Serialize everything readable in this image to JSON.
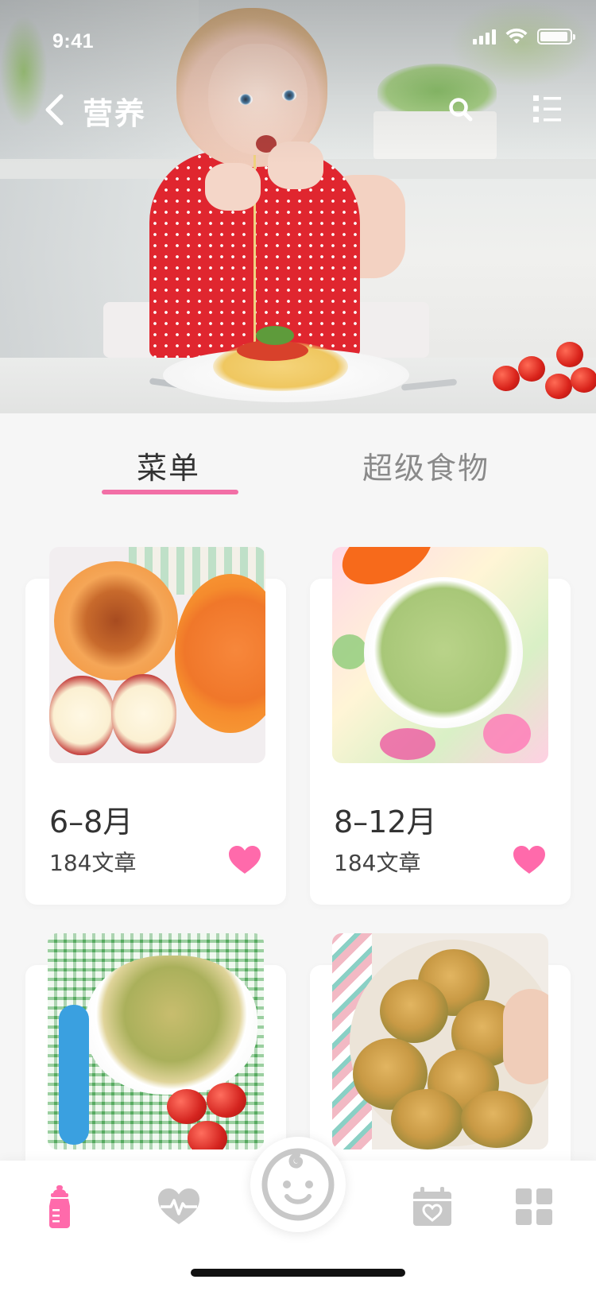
{
  "status_bar": {
    "time": "9:41",
    "signal_bars": 4,
    "battery_level": 0.95
  },
  "nav": {
    "title": "营养",
    "back_icon": "chevron-left-icon",
    "search_icon": "search-icon",
    "menu_icon": "list-icon"
  },
  "hero": {
    "photo": "child eating spaghetti"
  },
  "tabs": [
    {
      "label": "菜单",
      "active": true
    },
    {
      "label": "超级食物",
      "active": false
    }
  ],
  "cards": [
    {
      "title": "6–8月",
      "subtitle": "184文章",
      "photo": "squash, apples and orange puree",
      "favorite": true
    },
    {
      "title": "8–12月",
      "subtitle": "184文章",
      "photo": "green vegetable puree",
      "favorite": true
    },
    {
      "title": "",
      "subtitle": "",
      "photo": "orzo pasta salad",
      "favorite": false
    },
    {
      "title": "",
      "subtitle": "",
      "photo": "zucchini fritters",
      "favorite": false
    }
  ],
  "tabbar": {
    "items": [
      {
        "icon": "baby-bottle-icon",
        "active": true
      },
      {
        "icon": "heart-pulse-icon",
        "active": false
      },
      {
        "icon": "baby-face-icon",
        "active": false
      },
      {
        "icon": "calendar-heart-icon",
        "active": false
      },
      {
        "icon": "grid-icon",
        "active": false
      }
    ]
  },
  "colors": {
    "accent": "#f26fa6",
    "heart": "#ff6aab",
    "text_primary": "#333333",
    "text_secondary": "#8a8a8a",
    "icon_inactive": "#c8c8c8",
    "background": "#f6f6f6"
  }
}
